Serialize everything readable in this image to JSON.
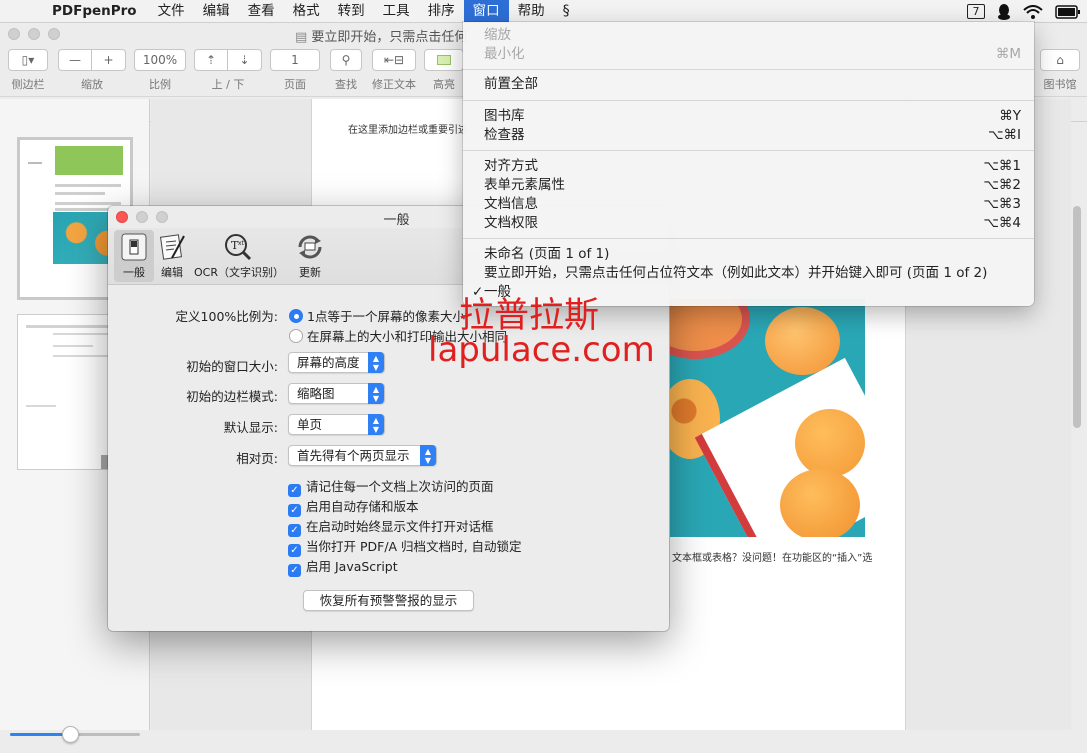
{
  "menubar": {
    "app_name": "PDFpenPro",
    "items": [
      "文件",
      "编辑",
      "查看",
      "格式",
      "转到",
      "工具",
      "排序",
      "窗口",
      "帮助"
    ],
    "active_item": "窗口",
    "notification_count": "7"
  },
  "window": {
    "title": "要立即开始，只需点击任何"
  },
  "toolbar": {
    "sidebar_label": "侧边栏",
    "zoom_label": "缩放",
    "zoom_minus": "—",
    "zoom_plus": "+",
    "scale_value": "100%",
    "scale_label": "比例",
    "updown_label": "上 / 下",
    "page_value": "1",
    "page_label": "页面",
    "search_label": "查找",
    "correct_label": "修正文本",
    "highlight_label": "高亮",
    "library_label": "图书馆"
  },
  "document": {
    "top_text": "在这里添加边栏或重要引述",
    "bottom_text": "文本框或表格？没问题！在功能区的“插入”选"
  },
  "prefs": {
    "title": "一般",
    "tabs": [
      {
        "label": "一般",
        "icon": "switch-icon"
      },
      {
        "label": "编辑",
        "icon": "edit-pen-icon"
      },
      {
        "label": "OCR（文字识别）",
        "icon": "ocr-text-icon"
      },
      {
        "label": "更新",
        "icon": "update-icon"
      }
    ],
    "scale_label": "定义100%比例为:",
    "scale_option1": "1点等于一个屏幕的像素大小",
    "scale_option2": "在屏幕上的大小和打印输出大小相同",
    "window_size_label": "初始的窗口大小:",
    "window_size_value": "屏幕的高度",
    "sidebar_mode_label": "初始的边栏模式:",
    "sidebar_mode_value": "缩略图",
    "default_display_label": "默认显示:",
    "default_display_value": "单页",
    "facing_label": "相对页:",
    "facing_value": "首先得有个两页显示",
    "checkboxes": [
      "请记住每一个文档上次访问的页面",
      "启用自动存储和版本",
      "在启动时始终显示文件打开对话框",
      "当你打开 PDF/A 归档文档时, 自动锁定",
      "启用 JavaScript"
    ],
    "reset_button": "恢复所有预警警报的显示"
  },
  "window_menu": {
    "zoom": "缩放",
    "minimize": "最小化",
    "minimize_shortcut": "⌘M",
    "bring_all_front": "前置全部",
    "library": "图书库",
    "library_shortcut": "⌘Y",
    "inspector": "检查器",
    "inspector_shortcut": "⌥⌘I",
    "alignment": "对齐方式",
    "alignment_shortcut": "⌥⌘1",
    "form_props": "表单元素属性",
    "form_props_shortcut": "⌥⌘2",
    "doc_info": "文档信息",
    "doc_info_shortcut": "⌥⌘3",
    "doc_perms": "文档权限",
    "doc_perms_shortcut": "⌥⌘4",
    "window1": "未命名 (页面 1 of 1)",
    "window2": "要立即开始，只需点击任何占位符文本（例如此文本）并开始键入即可 (页面 1 of 2)",
    "window3": "一般",
    "window3_check": "✓"
  },
  "watermark": {
    "line1": "拉普拉斯",
    "line2": "lapulace.com"
  },
  "zoom_slider": {
    "level_percent": 46
  },
  "colors": {
    "accent": "#2d6fd6",
    "watermark": "#e0201e"
  }
}
